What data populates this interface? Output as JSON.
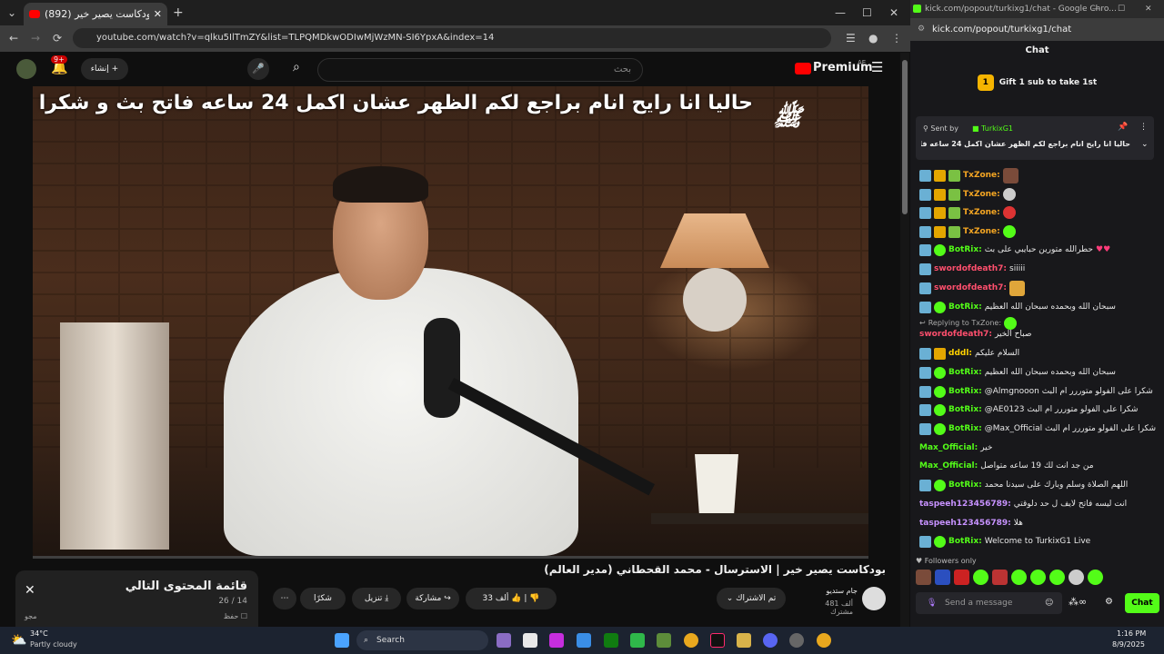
{
  "youtube": {
    "tab_title": "(892) بودكاست يصير خير",
    "url": "youtube.com/watch?v=qlku5IlTmZY&list=TLPQMDkwODIwMjWzMN-SI6YpxA&index=14",
    "notif_count": "9+",
    "create_label": "إنشاء",
    "search_placeholder": "بحث",
    "premium_label": "Premium",
    "premium_region": "AE",
    "video_caption": "حاليا انا رايح انام براجع لكم الظهر عشان اكمل 24 ساعه فاتح بث و شكرا",
    "video_title": "بودكاست يصير خير | الاسترسال - محمد القحطاني (مدير العالم)",
    "channel_name": "جام ستديو",
    "subscribers": "481 ألف مشترك",
    "subscribed_label": "تم الاشتراك",
    "like_count": "33 ألف",
    "share_label": "مشاركة",
    "download_label": "تنزيل",
    "thanks_label": "شكرًا",
    "playlist_title": "قائمة المحتوى التالي",
    "playlist_count": "26 / 14",
    "playlist_save": "حفظ",
    "playlist_sub": "مجو"
  },
  "chat": {
    "window_title": "kick.com/popout/turkixg1/chat - Google Chro...",
    "url": "kick.com/popout/turkixg1/chat",
    "header": "Chat",
    "gift_label": "Gift 1 sub to take 1st",
    "pinned_sent_by": "Sent by",
    "pinned_user": "TurkixG1",
    "pinned_text": "حاليا انا رايح انام براجع لكم الظهر عشان اكمل 24 ساعه فاتح بث و شكرا",
    "messages": [
      {
        "user": "TxZone:",
        "text": ""
      },
      {
        "user": "TxZone:",
        "text": ""
      },
      {
        "user": "TxZone:",
        "text": ""
      },
      {
        "user": "TxZone:",
        "text": ""
      },
      {
        "user": "BotRix:",
        "text": "حطرالله متورين حبايبي على بث"
      },
      {
        "user": "swordofdeath7:",
        "text": "siiiii"
      },
      {
        "user": "swordofdeath7:",
        "text": ""
      },
      {
        "user": "BotRix:",
        "text": "سبحان الله وبحمده سبحان الله العظيم"
      },
      {
        "user": "swordofdeath7:",
        "text": "صباح الخير"
      },
      {
        "user": "dddl:",
        "text": "السلام عليكم"
      },
      {
        "user": "BotRix:",
        "text": "سبحان الله وبحمده سبحان الله العظيم"
      },
      {
        "user": "BotRix:",
        "text": "@Almgnooon شكرا على الفولو متوررر ام البث"
      },
      {
        "user": "BotRix:",
        "text": "@AE0123 شكرا على الفولو متوررر ام البث"
      },
      {
        "user": "BotRix:",
        "text": "@Max_Official شكرا على الفولو متوررر ام البث"
      },
      {
        "user": "Max_Official:",
        "text": "خير"
      },
      {
        "user": "Max_Official:",
        "text": "من جد انت لك 19 ساعه متواصل"
      },
      {
        "user": "BotRix:",
        "text": "اللهم الصلاة وسلم وبارك على سيدنا محمد"
      },
      {
        "user": "taspeeh123456789:",
        "text": "انت ليسه فاتح لايف ل حد دلوقتي"
      },
      {
        "user": "taspeeh123456789:",
        "text": "هلا"
      },
      {
        "user": "BotRix:",
        "text": "Welcome to TurkixG1 Live"
      }
    ],
    "reply_to": "Replying to TxZone:",
    "followers_only": "Followers only",
    "input_placeholder": "Send a message",
    "chat_button": "Chat"
  },
  "taskbar": {
    "temp": "34°C",
    "weather": "Partly cloudy",
    "search_label": "Search",
    "time": "1:16 PM",
    "date": "8/9/2025"
  },
  "colors": {
    "kick_green": "#53fc18",
    "yt_red": "#ff0000"
  }
}
